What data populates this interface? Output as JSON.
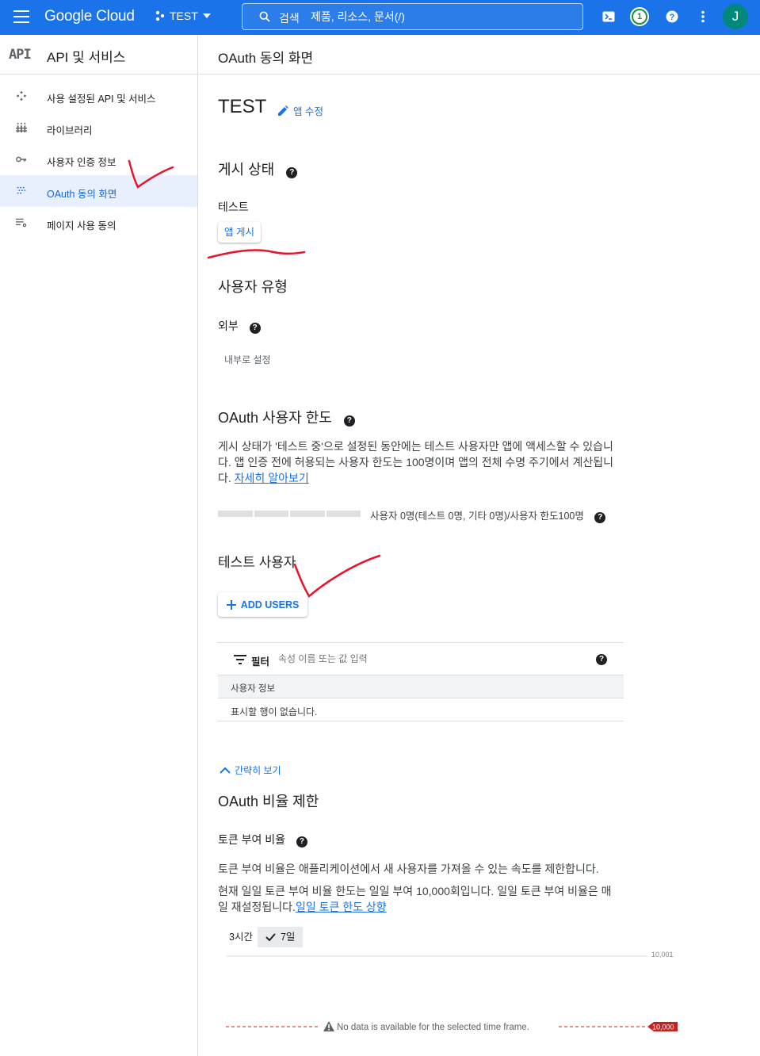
{
  "topbar": {
    "logo": "Google Cloud",
    "project": "TEST",
    "search_label": "검색",
    "search_placeholder": "제품, 리소스, 문서(/)",
    "notification_count": "1",
    "avatar_letter": "J"
  },
  "sidebar": {
    "api_icon_text": "API",
    "title": "API 및 서비스",
    "items": [
      {
        "label": "사용 설정된 API 및 서비스"
      },
      {
        "label": "라이브러리"
      },
      {
        "label": "사용자 인증 정보"
      },
      {
        "label": "OAuth 동의 화면"
      },
      {
        "label": "페이지 사용 동의"
      }
    ]
  },
  "header": {
    "title": "OAuth 동의 화면"
  },
  "app": {
    "name": "TEST",
    "edit_label": "앱 수정"
  },
  "publishing": {
    "title": "게시 상태",
    "status": "테스트",
    "publish_button": "앱 게시"
  },
  "user_type": {
    "title": "사용자 유형",
    "value": "외부",
    "make_internal": "내부로 설정"
  },
  "user_cap": {
    "title": "OAuth 사용자 한도",
    "line1": "게시 상태가 '테스트 중'으로 설정된 동안에는 테스트 사용자만 앱에 액세스할 수 있습니",
    "line2": "다. 앱 인증 전에 허용되는 사용자 한도는 100명이며 앱의 전체 수명 주기에서 계산됩니",
    "line3_prefix": "다. ",
    "learn_more": "자세히 알아보기",
    "usage_text": "사용자 0명(테스트 0명, 기타 0명)/사용자 한도100명"
  },
  "test_users": {
    "title": "테스트 사용자",
    "add_button": "ADD USERS",
    "filter_label": "필터",
    "filter_placeholder": "속성 이름 또는 값 입력",
    "column": "사용자 정보",
    "empty": "표시할 행이 없습니다."
  },
  "collapse": {
    "label": "간략히 보기"
  },
  "rate_limits": {
    "title": "OAuth 비율 제한",
    "subtitle": "토큰 부여 비율",
    "desc1": "토큰 부여 비율은 애플리케이션에서 새 사용자를 가져올 수 있는 속도를 제한합니다.",
    "desc2": "현재 일일 토큰 부여 비율 한도는 일일 부여 10,000회입니다. 일일 토큰 부여 비율은 매",
    "desc3_prefix": "일 재설정됩니다.",
    "desc3_link": "일일 토큰 한도 상향",
    "range_3h": "3시간",
    "range_7d": "7일"
  },
  "chart_data": {
    "type": "line",
    "y_top_label": "10,001",
    "threshold_label": "10,000",
    "no_data_message": "No data is available for the selected time frame.",
    "series": []
  },
  "colors": {
    "primary": "#1a73e8",
    "threshold": "#c5221f",
    "annotation": "#e8132c"
  }
}
